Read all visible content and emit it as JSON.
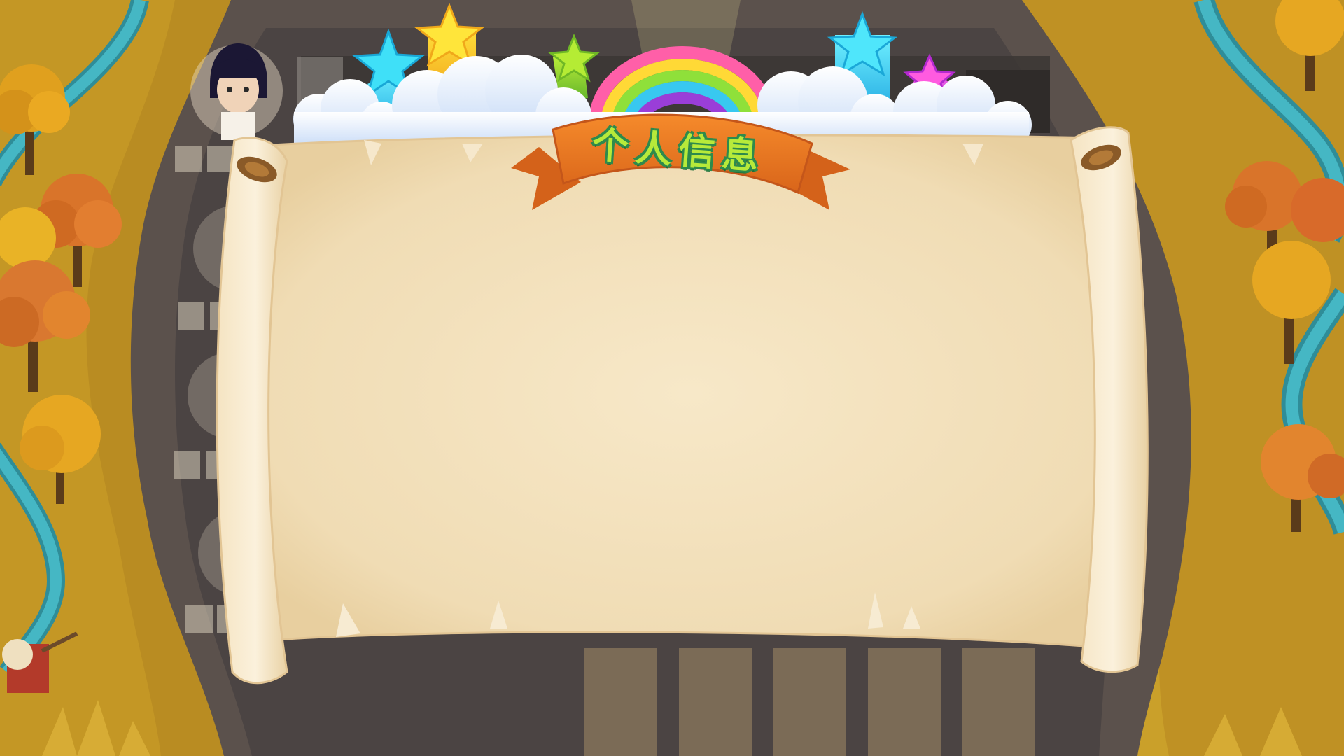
{
  "panel": {
    "title": "个人信息"
  },
  "colors": {
    "parchment": "#f3e2bf",
    "banner_orange": "#ee7a1e",
    "title_text": "#b7ea3a",
    "title_outline": "#2e8a4c",
    "path_grey": "#4f4a48",
    "foliage_gold": "#d9a21f",
    "river": "#3aa8b6",
    "tab_fill": "#7b6b56"
  },
  "icons": [
    "cyan-star-icon",
    "yellow-star-icon",
    "green-star-icon",
    "cyan-star-icon",
    "magenta-star-icon",
    "rainbow-icon",
    "cloud-icon",
    "scroll-curl-icon",
    "tree-icon",
    "scarecrow-icon"
  ]
}
